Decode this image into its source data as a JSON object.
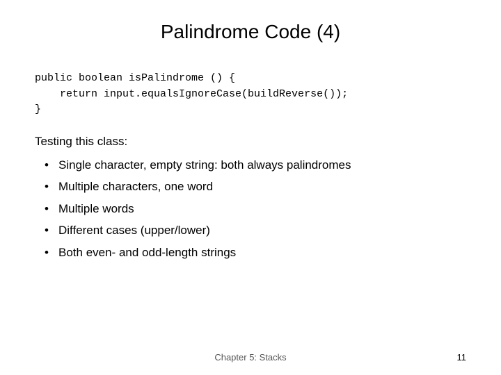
{
  "slide": {
    "title": "Palindrome Code (4)",
    "code": "public boolean isPalindrome () {\n    return input.equalsIgnoreCase(buildReverse());\n}",
    "testing_label": "Testing this class:",
    "bullets": [
      "Single character, empty string: both always palindromes",
      "Multiple characters, one word",
      "Multiple words",
      "Different cases (upper/lower)",
      "Both even- and odd-length strings"
    ],
    "footer": {
      "chapter": "Chapter 5: Stacks",
      "page": "11"
    }
  }
}
